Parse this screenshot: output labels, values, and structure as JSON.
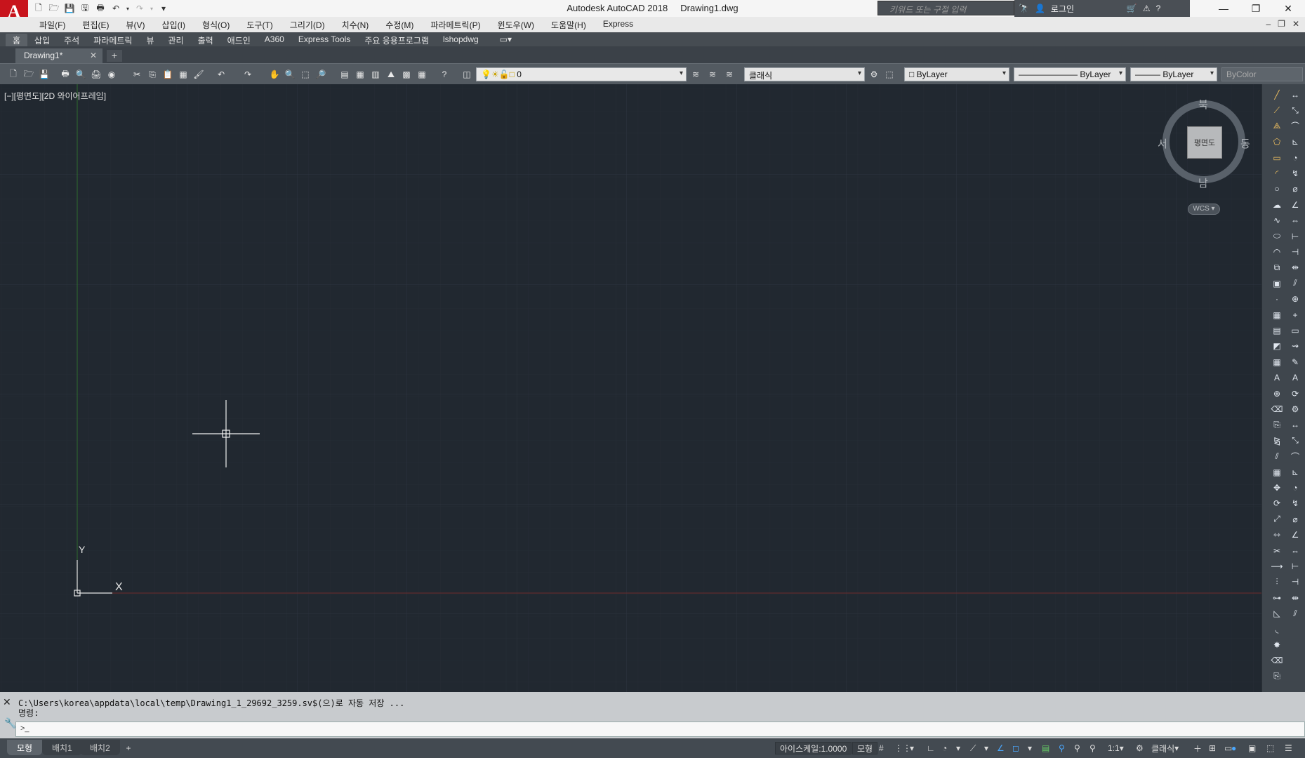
{
  "titlebar": {
    "app_logo": "A",
    "app_name": "Autodesk AutoCAD 2018",
    "file_name": "Drawing1.dwg",
    "search_placeholder": "키워드 또는 구절 입력",
    "login_label": "로그인"
  },
  "menu": {
    "items": [
      "파일(F)",
      "편집(E)",
      "뷰(V)",
      "삽입(I)",
      "형식(O)",
      "도구(T)",
      "그리기(D)",
      "치수(N)",
      "수정(M)",
      "파라메트릭(P)",
      "윈도우(W)",
      "도움말(H)",
      "Express"
    ]
  },
  "ribbon": {
    "tabs": [
      "홈",
      "삽입",
      "주석",
      "파라메트릭",
      "뷰",
      "관리",
      "출력",
      "애드인",
      "A360",
      "Express Tools",
      "주요 응용프로그램",
      "lshopdwg"
    ]
  },
  "filetabs": {
    "active": "Drawing1*",
    "new_tab": "+"
  },
  "toolbar": {
    "layer_value": "0",
    "style_value": "클래식",
    "color_value": "ByLayer",
    "linetype_value": "ByLayer",
    "lineweight_value": "ByLayer",
    "plotstyle_value": "ByColor"
  },
  "canvas": {
    "viewport_label": "[−][평면도][2D 와이어프레임]",
    "ucs_x": "X",
    "ucs_y": "Y",
    "viewcube": {
      "north": "북",
      "south": "남",
      "east": "동",
      "west": "서",
      "face": "평면도",
      "wcs": "WCS"
    }
  },
  "command": {
    "history_line1": "C:\\Users\\korea\\appdata\\local\\temp\\Drawing1_1_29692_3259.sv$(으)로 자동 저장 ...",
    "history_line2": "명령:",
    "prompt_icon": ">_"
  },
  "status": {
    "layout_tabs": [
      "모형",
      "배치1",
      "배치2"
    ],
    "add_tab": "+",
    "annotation_scale": "아이스케일:1.0000",
    "model_label": "모형",
    "scale_value": "1:1",
    "workspace": "클래식"
  },
  "colors": {
    "canvas_bg": "#212830",
    "grid_major": "#2c343d",
    "axis_x": "#7a2a2a",
    "axis_y": "#2b6a2b",
    "logo_red": "#c8141c"
  }
}
